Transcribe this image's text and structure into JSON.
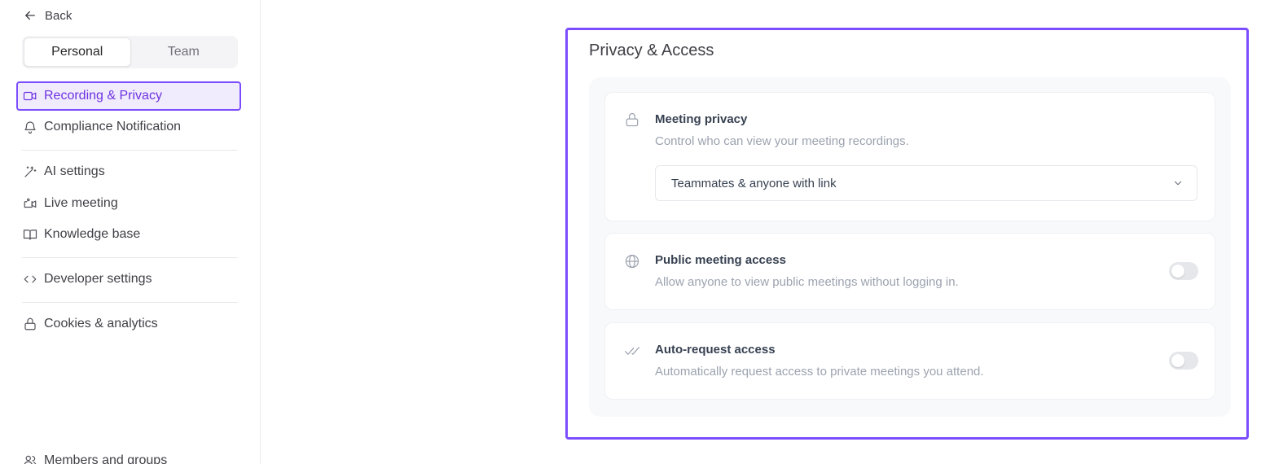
{
  "sidebar": {
    "back_label": "Back",
    "tabs": [
      {
        "label": "Personal",
        "active": true
      },
      {
        "label": "Team",
        "active": false
      }
    ],
    "items": [
      {
        "label": "Recording & Privacy",
        "icon": "video-icon",
        "active": true
      },
      {
        "label": "Compliance Notification",
        "icon": "bell-icon",
        "active": false
      },
      {
        "label": "AI settings",
        "icon": "magic-wand-icon",
        "active": false
      },
      {
        "label": "Live meeting",
        "icon": "live-video-icon",
        "active": false
      },
      {
        "label": "Knowledge base",
        "icon": "book-open-icon",
        "active": false
      },
      {
        "label": "Developer settings",
        "icon": "code-icon",
        "active": false
      },
      {
        "label": "Cookies & analytics",
        "icon": "lock-icon",
        "active": false
      },
      {
        "label": "Members and groups",
        "icon": "users-icon",
        "active": false
      }
    ]
  },
  "main": {
    "section_title": "Privacy & Access",
    "cards": [
      {
        "icon": "lock-icon",
        "title": "Meeting privacy",
        "description": "Control who can view your meeting recordings.",
        "select_value": "Teammates & anyone with link"
      },
      {
        "icon": "globe-icon",
        "title": "Public meeting access",
        "description": "Allow anyone to view public meetings without logging in.",
        "toggle_on": false
      },
      {
        "icon": "double-check-icon",
        "title": "Auto-request access",
        "description": "Automatically request access to private meetings you attend.",
        "toggle_on": false
      }
    ]
  },
  "colors": {
    "accent": "#7c4dff",
    "active_text": "#6d32e0",
    "active_bg": "#f1ecfd"
  }
}
